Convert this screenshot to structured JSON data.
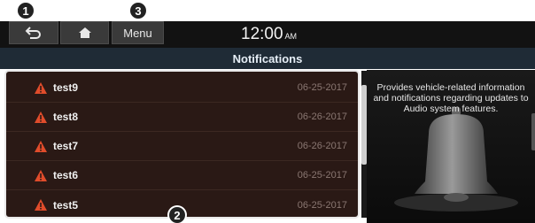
{
  "callouts": [
    "1",
    "2",
    "3"
  ],
  "topbar": {
    "back_icon": "back-arrow-icon",
    "home_icon": "home-icon",
    "menu_label": "Menu",
    "clock_time": "12:00",
    "clock_ampm": "AM"
  },
  "header": {
    "title": "Notifications"
  },
  "notifications": [
    {
      "name": "test9",
      "date": "06-25-2017"
    },
    {
      "name": "test8",
      "date": "06-26-2017"
    },
    {
      "name": "test7",
      "date": "06-26-2017"
    },
    {
      "name": "test6",
      "date": "06-25-2017"
    },
    {
      "name": "test5",
      "date": "06-25-2017"
    }
  ],
  "info_panel": {
    "line1": "Provides vehicle-related information",
    "line2": "and notifications regarding updates to",
    "line3": "Audio system features."
  },
  "colors": {
    "warning": "#e04c2b",
    "list_bg": "#2a1915",
    "title_bg": "#1f2b36"
  }
}
